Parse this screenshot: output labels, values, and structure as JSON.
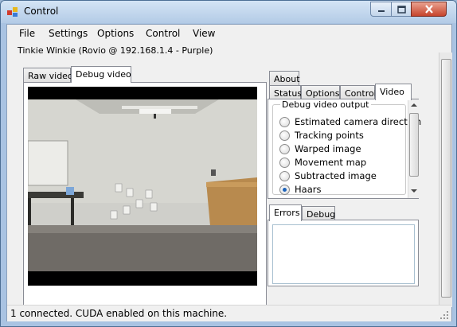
{
  "window": {
    "title": "Control",
    "icon": "app-icon",
    "buttons": [
      "minimize-icon",
      "maximize-icon",
      "close-icon"
    ]
  },
  "menu": {
    "items": [
      "File",
      "Settings",
      "Options",
      "Control",
      "View"
    ]
  },
  "connection_label": "Tinkie Winkie (Rovio @ 192.168.1.4 - Purple)",
  "video_tabs": {
    "tabs": [
      "Raw video",
      "Debug video"
    ],
    "active": "Debug video"
  },
  "right_tabs": {
    "top_row": [
      "About"
    ],
    "bottom_row": [
      "Status",
      "Options",
      "Control",
      "Video"
    ],
    "active": "Video"
  },
  "debug_output": {
    "legend": "Debug video output",
    "options": [
      "Estimated camera direction",
      "Tracking points",
      "Warped image",
      "Movement map",
      "Subtracted image",
      "Haars"
    ],
    "selected": "Haars"
  },
  "log_tabs": {
    "tabs": [
      "Errors",
      "Debug"
    ],
    "active": "Errors"
  },
  "status": {
    "text": "1 connected. CUDA enabled on this machine."
  },
  "colors": {
    "titlebar": "#c2d6ec",
    "close_button": "#c6442c",
    "radio_checked": "#1e63b9"
  }
}
